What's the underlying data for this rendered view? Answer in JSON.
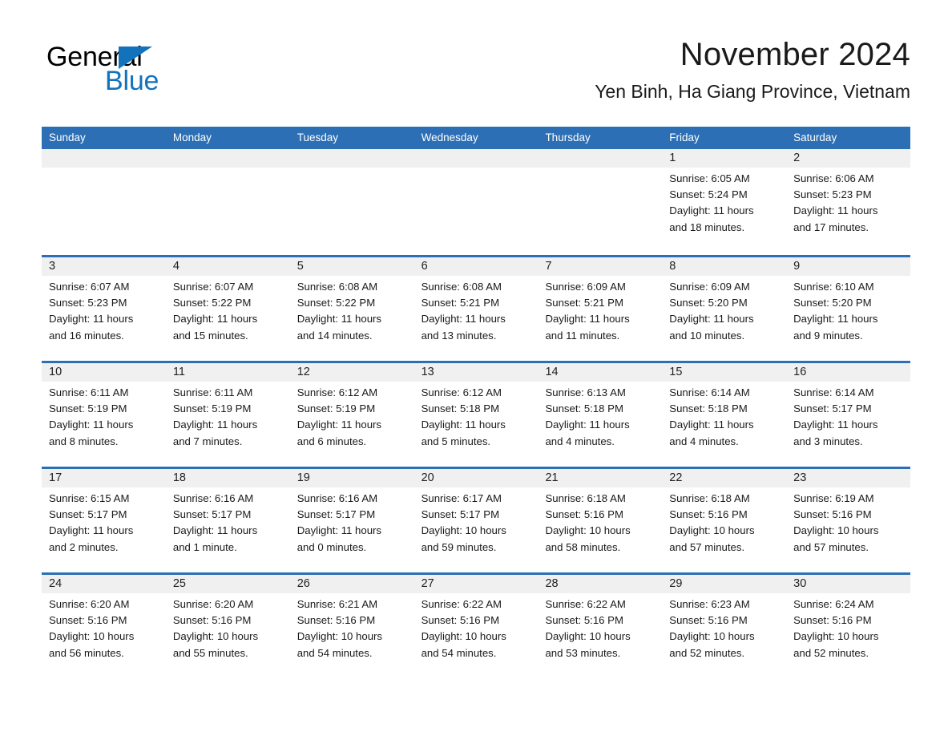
{
  "brand": {
    "name_part1": "General",
    "name_part2": "Blue",
    "accent_color": "#1272bc"
  },
  "header": {
    "month_title": "November 2024",
    "location": "Yen Binh, Ha Giang Province, Vietnam"
  },
  "theme": {
    "header_blue": "#2c6fb5",
    "day_band_gray": "#f0f0f0",
    "text_color": "#1a1a1a"
  },
  "weekdays": [
    "Sunday",
    "Monday",
    "Tuesday",
    "Wednesday",
    "Thursday",
    "Friday",
    "Saturday"
  ],
  "weeks": [
    [
      {
        "day": "",
        "lines": []
      },
      {
        "day": "",
        "lines": []
      },
      {
        "day": "",
        "lines": []
      },
      {
        "day": "",
        "lines": []
      },
      {
        "day": "",
        "lines": []
      },
      {
        "day": "1",
        "lines": [
          "Sunrise: 6:05 AM",
          "Sunset: 5:24 PM",
          "Daylight: 11 hours",
          "and 18 minutes."
        ]
      },
      {
        "day": "2",
        "lines": [
          "Sunrise: 6:06 AM",
          "Sunset: 5:23 PM",
          "Daylight: 11 hours",
          "and 17 minutes."
        ]
      }
    ],
    [
      {
        "day": "3",
        "lines": [
          "Sunrise: 6:07 AM",
          "Sunset: 5:23 PM",
          "Daylight: 11 hours",
          "and 16 minutes."
        ]
      },
      {
        "day": "4",
        "lines": [
          "Sunrise: 6:07 AM",
          "Sunset: 5:22 PM",
          "Daylight: 11 hours",
          "and 15 minutes."
        ]
      },
      {
        "day": "5",
        "lines": [
          "Sunrise: 6:08 AM",
          "Sunset: 5:22 PM",
          "Daylight: 11 hours",
          "and 14 minutes."
        ]
      },
      {
        "day": "6",
        "lines": [
          "Sunrise: 6:08 AM",
          "Sunset: 5:21 PM",
          "Daylight: 11 hours",
          "and 13 minutes."
        ]
      },
      {
        "day": "7",
        "lines": [
          "Sunrise: 6:09 AM",
          "Sunset: 5:21 PM",
          "Daylight: 11 hours",
          "and 11 minutes."
        ]
      },
      {
        "day": "8",
        "lines": [
          "Sunrise: 6:09 AM",
          "Sunset: 5:20 PM",
          "Daylight: 11 hours",
          "and 10 minutes."
        ]
      },
      {
        "day": "9",
        "lines": [
          "Sunrise: 6:10 AM",
          "Sunset: 5:20 PM",
          "Daylight: 11 hours",
          "and 9 minutes."
        ]
      }
    ],
    [
      {
        "day": "10",
        "lines": [
          "Sunrise: 6:11 AM",
          "Sunset: 5:19 PM",
          "Daylight: 11 hours",
          "and 8 minutes."
        ]
      },
      {
        "day": "11",
        "lines": [
          "Sunrise: 6:11 AM",
          "Sunset: 5:19 PM",
          "Daylight: 11 hours",
          "and 7 minutes."
        ]
      },
      {
        "day": "12",
        "lines": [
          "Sunrise: 6:12 AM",
          "Sunset: 5:19 PM",
          "Daylight: 11 hours",
          "and 6 minutes."
        ]
      },
      {
        "day": "13",
        "lines": [
          "Sunrise: 6:12 AM",
          "Sunset: 5:18 PM",
          "Daylight: 11 hours",
          "and 5 minutes."
        ]
      },
      {
        "day": "14",
        "lines": [
          "Sunrise: 6:13 AM",
          "Sunset: 5:18 PM",
          "Daylight: 11 hours",
          "and 4 minutes."
        ]
      },
      {
        "day": "15",
        "lines": [
          "Sunrise: 6:14 AM",
          "Sunset: 5:18 PM",
          "Daylight: 11 hours",
          "and 4 minutes."
        ]
      },
      {
        "day": "16",
        "lines": [
          "Sunrise: 6:14 AM",
          "Sunset: 5:17 PM",
          "Daylight: 11 hours",
          "and 3 minutes."
        ]
      }
    ],
    [
      {
        "day": "17",
        "lines": [
          "Sunrise: 6:15 AM",
          "Sunset: 5:17 PM",
          "Daylight: 11 hours",
          "and 2 minutes."
        ]
      },
      {
        "day": "18",
        "lines": [
          "Sunrise: 6:16 AM",
          "Sunset: 5:17 PM",
          "Daylight: 11 hours",
          "and 1 minute."
        ]
      },
      {
        "day": "19",
        "lines": [
          "Sunrise: 6:16 AM",
          "Sunset: 5:17 PM",
          "Daylight: 11 hours",
          "and 0 minutes."
        ]
      },
      {
        "day": "20",
        "lines": [
          "Sunrise: 6:17 AM",
          "Sunset: 5:17 PM",
          "Daylight: 10 hours",
          "and 59 minutes."
        ]
      },
      {
        "day": "21",
        "lines": [
          "Sunrise: 6:18 AM",
          "Sunset: 5:16 PM",
          "Daylight: 10 hours",
          "and 58 minutes."
        ]
      },
      {
        "day": "22",
        "lines": [
          "Sunrise: 6:18 AM",
          "Sunset: 5:16 PM",
          "Daylight: 10 hours",
          "and 57 minutes."
        ]
      },
      {
        "day": "23",
        "lines": [
          "Sunrise: 6:19 AM",
          "Sunset: 5:16 PM",
          "Daylight: 10 hours",
          "and 57 minutes."
        ]
      }
    ],
    [
      {
        "day": "24",
        "lines": [
          "Sunrise: 6:20 AM",
          "Sunset: 5:16 PM",
          "Daylight: 10 hours",
          "and 56 minutes."
        ]
      },
      {
        "day": "25",
        "lines": [
          "Sunrise: 6:20 AM",
          "Sunset: 5:16 PM",
          "Daylight: 10 hours",
          "and 55 minutes."
        ]
      },
      {
        "day": "26",
        "lines": [
          "Sunrise: 6:21 AM",
          "Sunset: 5:16 PM",
          "Daylight: 10 hours",
          "and 54 minutes."
        ]
      },
      {
        "day": "27",
        "lines": [
          "Sunrise: 6:22 AM",
          "Sunset: 5:16 PM",
          "Daylight: 10 hours",
          "and 54 minutes."
        ]
      },
      {
        "day": "28",
        "lines": [
          "Sunrise: 6:22 AM",
          "Sunset: 5:16 PM",
          "Daylight: 10 hours",
          "and 53 minutes."
        ]
      },
      {
        "day": "29",
        "lines": [
          "Sunrise: 6:23 AM",
          "Sunset: 5:16 PM",
          "Daylight: 10 hours",
          "and 52 minutes."
        ]
      },
      {
        "day": "30",
        "lines": [
          "Sunrise: 6:24 AM",
          "Sunset: 5:16 PM",
          "Daylight: 10 hours",
          "and 52 minutes."
        ]
      }
    ]
  ]
}
